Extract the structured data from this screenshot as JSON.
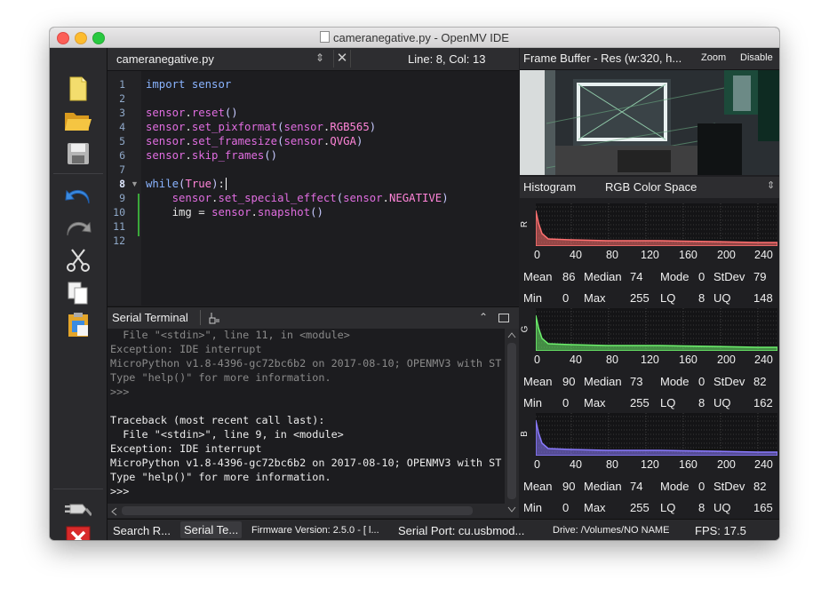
{
  "window": {
    "title": "cameranegative.py - OpenMV IDE"
  },
  "toolbar": {
    "items": [
      "new-file-icon",
      "open-file-icon",
      "save-icon",
      "undo-icon",
      "redo-icon",
      "cut-icon",
      "copy-icon",
      "paste-icon",
      "connect-icon",
      "stop-icon"
    ]
  },
  "editor": {
    "filename": "cameranegative.py",
    "arrows": "⇕",
    "close": "✕",
    "position": "Line: 8, Col: 13",
    "line_numbers": [
      "1",
      "2",
      "3",
      "4",
      "5",
      "6",
      "7",
      "8",
      "9",
      "10",
      "11",
      "12"
    ],
    "fold_marker": "▼"
  },
  "terminal": {
    "title": "Serial Terminal",
    "collapse": "⌃",
    "lines": [
      "  File \"<stdin>\", line 11, in <module>",
      "Exception: IDE interrupt",
      "MicroPython v1.8-4396-gc72bc6b2 on 2017-08-10; OPENMV3 with ST",
      "Type \"help()\" for more information.",
      ">>>",
      "",
      "Traceback (most recent call last):",
      "  File \"<stdin>\", line 9, in <module>",
      "Exception: IDE interrupt",
      "MicroPython v1.8-4396-gc72bc6b2 on 2017-08-10; OPENMV3 with ST",
      "Type \"help()\" for more information.",
      ">>>"
    ]
  },
  "framebuffer": {
    "title": "Frame Buffer - Res (w:320, h...",
    "zoom": "Zoom",
    "disable": "Disable"
  },
  "histogram": {
    "label": "Histogram",
    "color_space": "RGB Color Space",
    "arrows": "⇕",
    "ticks": [
      "0",
      "40",
      "80",
      "120",
      "160",
      "200",
      "240"
    ],
    "channels": [
      {
        "name": "R",
        "color": "#ff7070",
        "row1": {
          "mean": "86",
          "median": "74",
          "mode": "0",
          "stdev": "79"
        },
        "row2": {
          "min": "0",
          "max": "255",
          "lq": "8",
          "uq": "148"
        }
      },
      {
        "name": "G",
        "color": "#6cf06c",
        "row1": {
          "mean": "90",
          "median": "73",
          "mode": "0",
          "stdev": "82"
        },
        "row2": {
          "min": "0",
          "max": "255",
          "lq": "8",
          "uq": "162"
        }
      },
      {
        "name": "B",
        "color": "#8a7aff",
        "row1": {
          "mean": "90",
          "median": "74",
          "mode": "0",
          "stdev": "82"
        },
        "row2": {
          "min": "0",
          "max": "255",
          "lq": "8",
          "uq": "165"
        }
      }
    ],
    "labels": {
      "mean": "Mean",
      "median": "Median",
      "mode": "Mode",
      "stdev": "StDev",
      "min": "Min",
      "max": "Max",
      "lq": "LQ",
      "uq": "UQ"
    }
  },
  "statusbar": {
    "search": "Search R...",
    "serial_tab": "Serial Te...",
    "firmware": "Firmware Version: 2.5.0 - [ l...",
    "port": "Serial Port: cu.usbmod...",
    "drive": "Drive: /Volumes/NO NAME",
    "fps": "FPS:  17.5"
  }
}
